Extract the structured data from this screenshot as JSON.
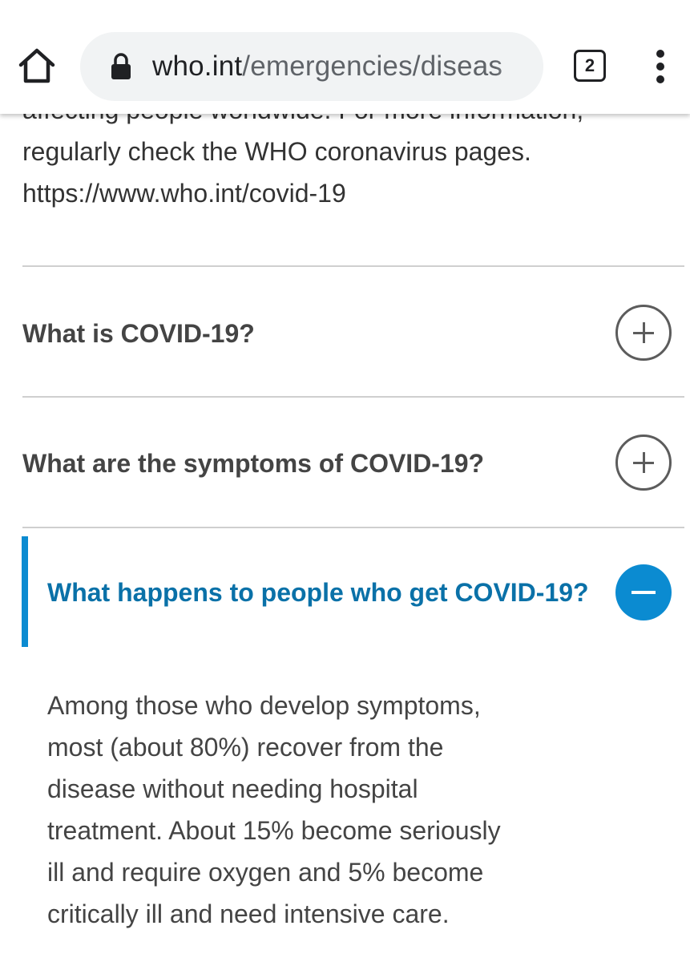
{
  "browser": {
    "url_domain": "who.int",
    "url_path": "/emergencies/diseas",
    "tab_count": "2",
    "icons": {
      "home": "home-icon",
      "lock": "lock-icon",
      "tabs": "tab-switcher-icon",
      "menu": "overflow-menu-icon"
    }
  },
  "intro": {
    "cut_line": "affecting people worldwide. For more information,",
    "line_2": "regularly check the WHO coronavirus pages.",
    "line_3": "https://www.who.int/covid-19"
  },
  "faq": {
    "items": [
      {
        "question": "What is COVID-19?",
        "state": "collapsed",
        "icon": "plus-circle-icon"
      },
      {
        "question": "What are the symptoms of COVID-19?",
        "state": "collapsed",
        "icon": "plus-circle-icon"
      },
      {
        "question": "What happens to people who get COVID-19?",
        "state": "expanded",
        "icon": "minus-circle-icon",
        "answer_lines": [
          "Among those who develop symptoms,",
          "most (about 80%) recover from the",
          "disease without needing hospital",
          "treatment. About 15% become seriously",
          "ill and require oxygen and 5% become",
          "critically ill and need intensive care."
        ]
      }
    ]
  },
  "colors": {
    "accent": "#0b8bd1",
    "active_question": "#0a71a8",
    "text": "#444444",
    "divider": "#cfcfcf"
  }
}
